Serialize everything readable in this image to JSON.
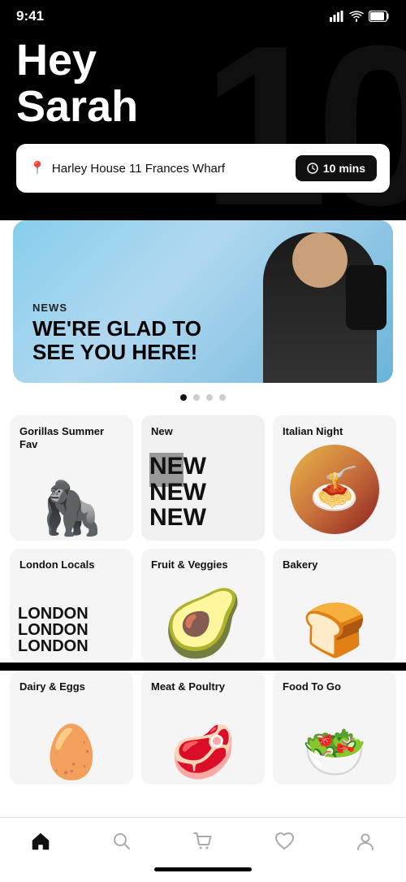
{
  "status": {
    "time": "9:41",
    "signal": "●●●●",
    "wifi": "wifi",
    "battery": "battery"
  },
  "hero": {
    "watermark": "10",
    "greeting_line1": "Hey",
    "greeting_line2": "Sarah",
    "address": "Harley House 11 Frances Wharf",
    "time_badge": "10 mins"
  },
  "banner": {
    "news_label": "NEWS",
    "title_line1": "WE'RE GLAD TO",
    "title_line2": "SEE YOU HERE!"
  },
  "dots": {
    "active_index": 0,
    "count": 4
  },
  "grid": {
    "cells": [
      {
        "id": "gorillas",
        "label": "Gorillas Summer Fav",
        "emoji": "🦍"
      },
      {
        "id": "new",
        "label": "New",
        "big_text_line1": "NEW",
        "big_text_line2": "NEW",
        "big_text_line3": "NEW"
      },
      {
        "id": "italian",
        "label": "Italian Night",
        "emoji": "🍝"
      },
      {
        "id": "london",
        "label": "London Locals",
        "big_text": "LONDON\nLONDON\nLONDON"
      },
      {
        "id": "fruit",
        "label": "Fruit & Veggies",
        "emoji": "🥑"
      },
      {
        "id": "bakery",
        "label": "Bakery",
        "emoji": "🍞"
      },
      {
        "id": "dairy",
        "label": "Dairy & Eggs",
        "emoji": "🥚"
      },
      {
        "id": "meat",
        "label": "Meat & Poultry",
        "emoji": "🥩"
      },
      {
        "id": "food",
        "label": "Food To Go",
        "emoji": "🥗"
      }
    ]
  },
  "nav": {
    "items": [
      {
        "id": "home",
        "icon": "⌂",
        "active": true
      },
      {
        "id": "search",
        "icon": "⌕",
        "active": false
      },
      {
        "id": "cart",
        "icon": "🛒",
        "active": false
      },
      {
        "id": "heart",
        "icon": "♡",
        "active": false
      },
      {
        "id": "profile",
        "icon": "👤",
        "active": false
      }
    ]
  }
}
